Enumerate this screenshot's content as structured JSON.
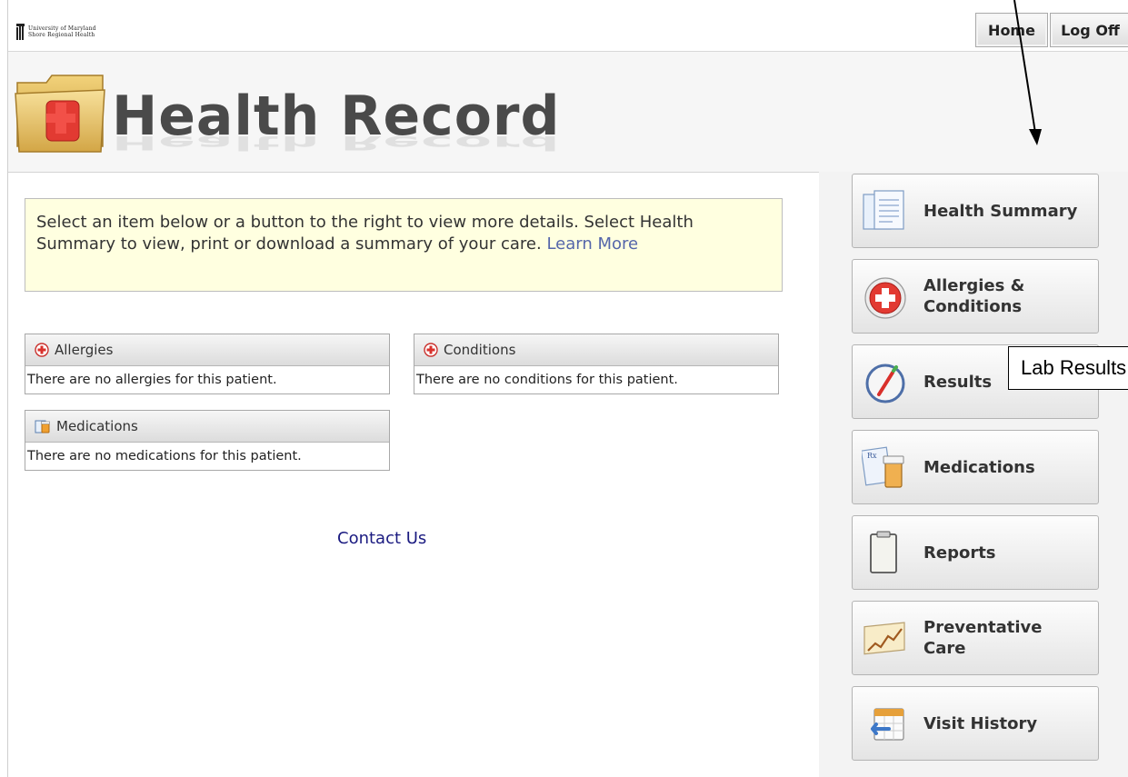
{
  "header": {
    "org_logo_line1": "University of Maryland",
    "org_logo_line2": "Shore Regional Health",
    "home_label": "Home",
    "logoff_label": "Log Off",
    "page_title": "Health Record"
  },
  "info": {
    "text": "Select an item below or a button to the right to view more details. Select Health Summary to view, print or download a summary of your care. ",
    "link": "Learn More"
  },
  "panels": [
    {
      "title": "Allergies",
      "body": "There are no allergies for this patient."
    },
    {
      "title": "Conditions",
      "body": "There are no conditions for this patient."
    },
    {
      "title": "Medications",
      "body": "There are no medications for this patient."
    }
  ],
  "footer": {
    "contact_label": "Contact Us"
  },
  "sidebar": {
    "items": [
      {
        "label": "Health Summary",
        "icon": "documents-icon"
      },
      {
        "label": "Allergies & Conditions",
        "icon": "red-cross-icon"
      },
      {
        "label": "Results",
        "icon": "thermometer-icon"
      },
      {
        "label": "Medications",
        "icon": "prescription-bottle-icon"
      },
      {
        "label": "Reports",
        "icon": "clipboard-icon"
      },
      {
        "label": "Preventative Care",
        "icon": "trend-chart-icon"
      },
      {
        "label": "Visit History",
        "icon": "calendar-return-icon"
      }
    ]
  },
  "annotation": {
    "callout_text": "Lab Results"
  },
  "colors": {
    "accent_red": "#d9302b",
    "link_blue": "#5566aa",
    "contact_blue": "#1a1a80",
    "info_bg": "#ffffe0"
  }
}
